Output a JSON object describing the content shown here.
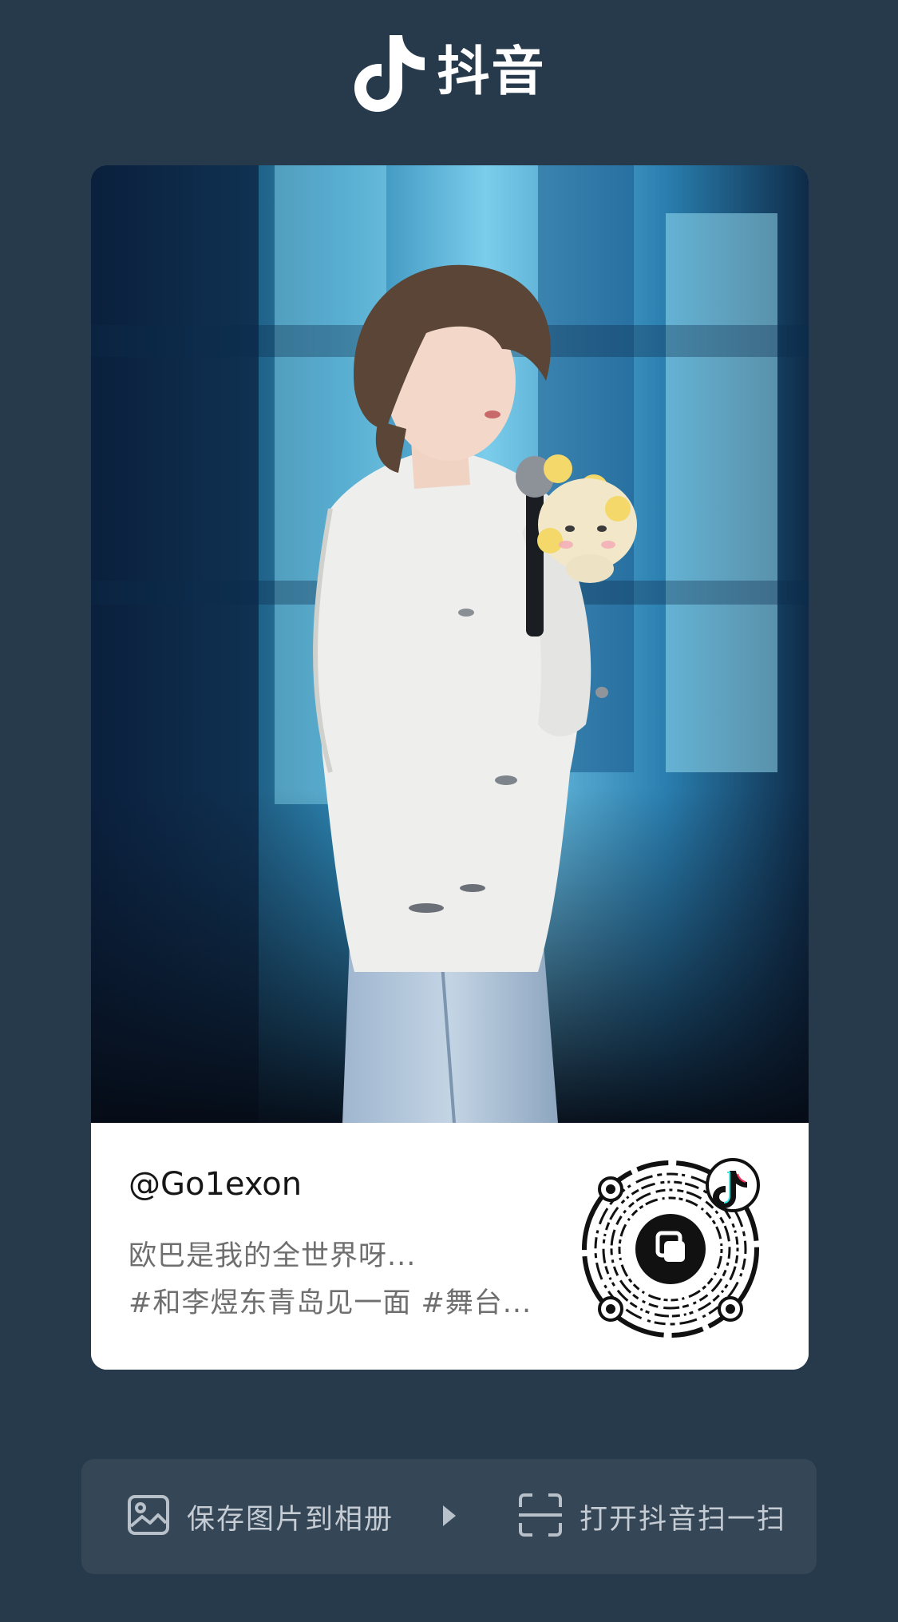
{
  "brand": {
    "name": "抖音",
    "icon": "douyin-note-logo"
  },
  "card": {
    "username": "@Go1exon",
    "caption_line1": "欧巴是我的全世界呀...",
    "caption_line2": "#和李煜东青岛见一面  #舞台...",
    "qr_icon": "douyin-qr-code",
    "qr_center_icon": "copy-icon"
  },
  "actions": {
    "save_label": "保存图片到相册",
    "save_icon": "image-icon",
    "divider_icon": "play-arrow-icon",
    "scan_label": "打开抖音扫一扫",
    "scan_icon": "scan-icon"
  },
  "colors": {
    "background": "#273a4c",
    "action_bar": "#354657",
    "card": "#ffffff",
    "accent_cyan": "#25f4ee",
    "accent_red": "#fe2c55"
  }
}
